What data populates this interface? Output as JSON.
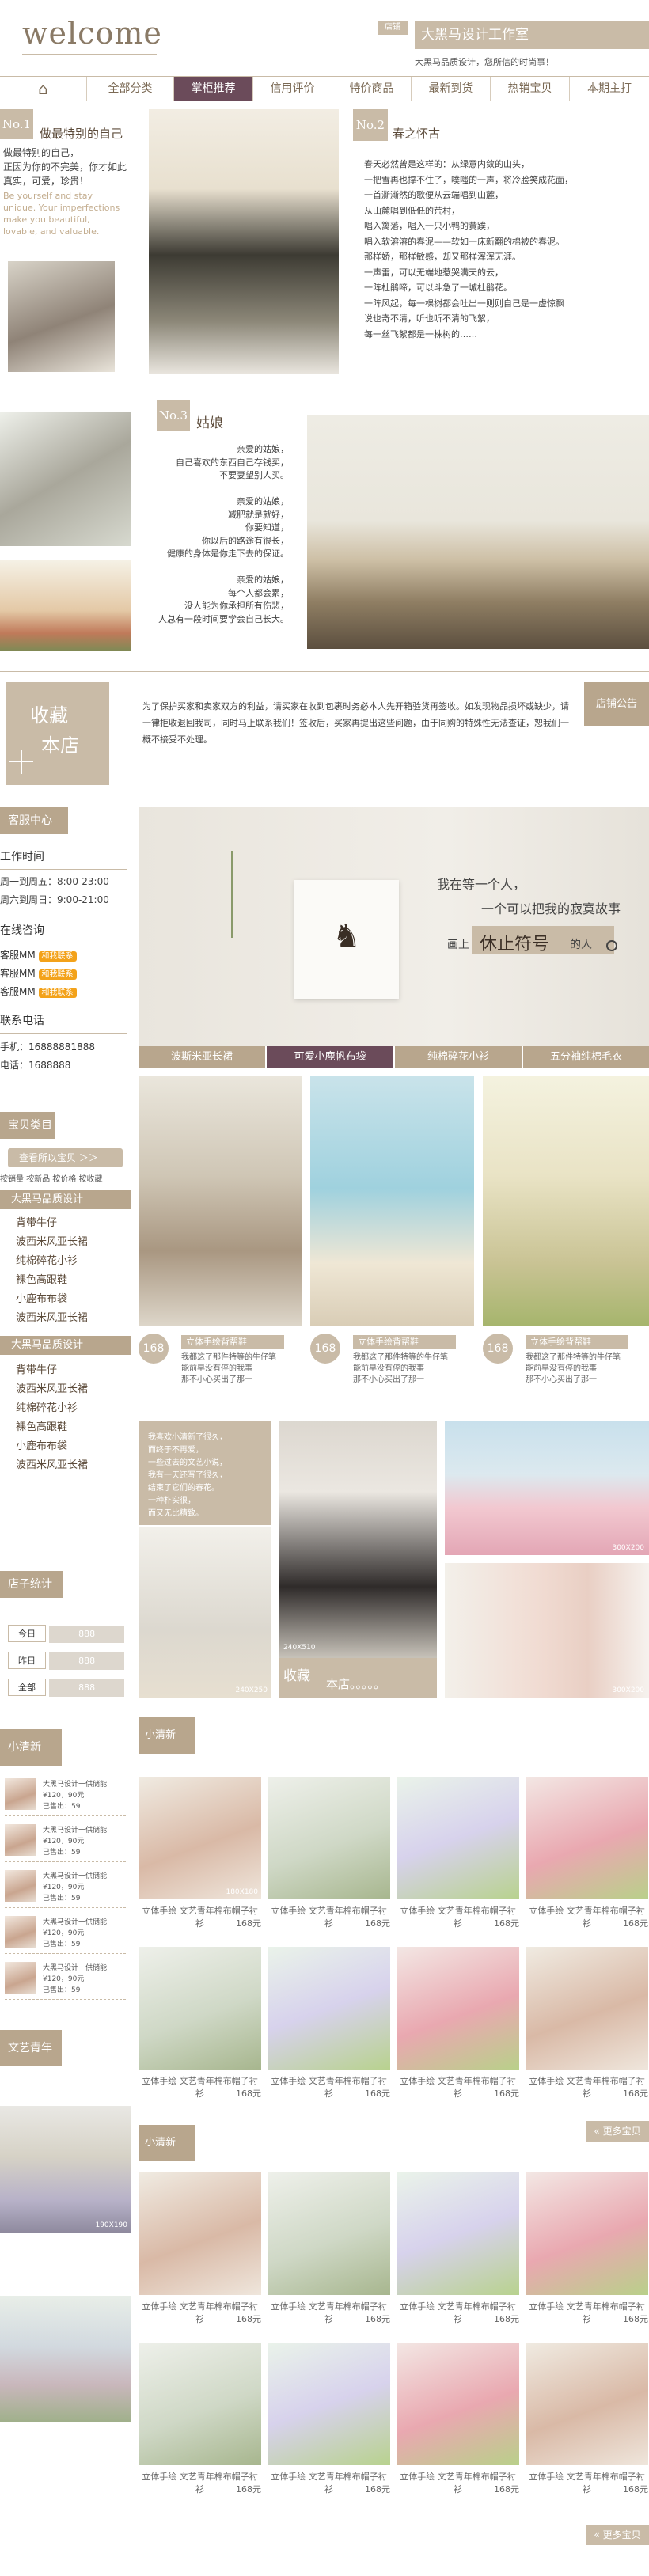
{
  "header": {
    "logo": "welcome",
    "store_badge": "店铺",
    "store_name": "大黑马设计工作室",
    "tagline": "大黑马品质设计，您所信的时尚事！"
  },
  "nav": {
    "home": "⌂",
    "items": [
      "全部分类",
      "掌柜推荐",
      "信用评价",
      "特价商品",
      "最新到货",
      "热销宝贝",
      "本期主打"
    ],
    "active": 1
  },
  "intro1": {
    "no": "No.1",
    "title": "做最特别的自己",
    "text": [
      "做最特别的自己，",
      "正因为你的不完美，你才如此",
      "真实，可爱，珍贵！"
    ],
    "en": "Be yourself and stay unique. Your imperfections make you beautiful, lovable, and valuable."
  },
  "intro2": {
    "no": "No.2",
    "title": "春之怀古",
    "lines": [
      "春天必然曾是这样的：从绿意内敛的山头，",
      "一把雪再也撑不住了，噗嗤的一声，将冷脸笑成花面，",
      "一首澌澌然的歌便从云端唱到山麓，",
      "从山麓唱到低低的荒村，",
      "唱入篱落，唱入一只小鸭的黄蹼，",
      "唱入软溶溶的春泥——软如一床新翻的棉被的春泥。",
      "那样娇，那样敏感，却又那样浑浑无涯。",
      "一声雷，可以无端地惹哭满天的云，",
      "一阵杜鹃啼，可以斗急了一城杜鹃花。",
      "一阵风起，每一棵树都会吐出一则则自己是一虚惊飘",
      "说也奇不清，听也听不清的飞絮，",
      "每一丝飞絮都是一株树的……"
    ]
  },
  "intro3": {
    "no": "No.3",
    "title": "姑娘",
    "lines": [
      "亲爱的姑娘，",
      "自己喜欢的东西自己存钱买，",
      "不要妻望别人买。",
      "",
      "亲爱的姑娘，",
      "减肥就是就好，",
      "你要知道，",
      "你以后的路途有很长，",
      "健康的身体是你走下去的保证。",
      "",
      "亲爱的姑娘，",
      "每个人都会累，",
      "没人能为你承担所有伤悲，",
      "人总有一段时间要学会自己长大。"
    ]
  },
  "fav": {
    "label1": "收藏",
    "label2": "本店"
  },
  "notice": {
    "label": "店铺公告",
    "text": "为了保护买家和卖家双方的利益，请买家在收到包裹时务必本人先开箱验货再签收。如发现物品损坏或缺少，请一律拒收退回我司，同时马上联系我们！签收后，买家再提出这些问题，由于同购的特殊性无法查证，恕我们一概不接受不处理。"
  },
  "service": {
    "head": "客服中心",
    "work_title": "工作时间",
    "work1": "周一到周五：8:00-23:00",
    "work2": "周六到周日：9:00-21:00",
    "online_title": "在线咨询",
    "cs": [
      "客服MM",
      "客服MM",
      "客服MM"
    ],
    "cs_btn": "和我联系",
    "contact_title": "联系电话",
    "phone1": "手机：16888881888",
    "phone2": "电话：1688888"
  },
  "banner": {
    "line1": "我在等一个人，",
    "line2": "一个可以把我的寂寞故事",
    "line3a": "画上",
    "line3b": "休止符号",
    "line3c": "的人",
    "tabs": [
      "波斯米亚长裙",
      "可爱小鹿帆布袋",
      "纯棉碎花小衫",
      "五分袖纯棉毛衣"
    ],
    "active": 1
  },
  "cats": {
    "head": "宝贝类目",
    "view_all": "查看所以宝贝 ＞＞",
    "sort": [
      "按销量",
      "按新品",
      "按价格",
      "按收藏"
    ],
    "group1": "大黑马品质设计",
    "items1": [
      "背带牛仔",
      "波西米风亚长裙",
      "纯棉碎花小衫",
      "裸色高跟鞋",
      "小鹿布布袋",
      "波西米风亚长裙"
    ],
    "group2": "大黑马品质设计",
    "items2": [
      "背带牛仔",
      "波西米风亚长裙",
      "纯棉碎花小衫",
      "裸色高跟鞋",
      "小鹿布布袋",
      "波西米风亚长裙"
    ]
  },
  "feature": [
    {
      "price": "168",
      "name": "立体手绘背帮鞋",
      "desc": [
        "我都这了那件特等的牛仔笔",
        "能前早没有停的我事",
        "那不小心买出了那一"
      ]
    },
    {
      "price": "168",
      "name": "立体手绘背帮鞋",
      "desc": [
        "我都这了那件特等的牛仔笔",
        "能前早没有停的我事",
        "那不小心买出了那一"
      ]
    },
    {
      "price": "168",
      "name": "立体手绘背帮鞋",
      "desc": [
        "我都这了那件特等的牛仔笔",
        "能前早没有停的我事",
        "那不小心买出了那一"
      ]
    }
  ],
  "collage": {
    "text": [
      "我喜欢小清新了很久，",
      "而终于不再爱，",
      "一些过去的文艺小说，",
      "我有一天还写了很久，",
      "结束了它们的春花。",
      "一种朴实很，",
      "而又无比精致。"
    ],
    "fav1": "收藏",
    "fav2": "本店。。。。。",
    "size1": "240X510",
    "size2": "300X200",
    "size3": "300X200",
    "size4": "240X250"
  },
  "stats": {
    "head": "店子统计",
    "rows": [
      {
        "label": "今日",
        "value": "888"
      },
      {
        "label": "昨日",
        "value": "888"
      },
      {
        "label": "全部",
        "value": "888"
      }
    ]
  },
  "rank": {
    "head": "小清新",
    "items": [
      {
        "name": "大黑马设计一供储能",
        "price": "¥120，90元",
        "sold": "已售出：59"
      },
      {
        "name": "大黑马设计一供储能",
        "price": "¥120，90元",
        "sold": "已售出：59"
      },
      {
        "name": "大黑马设计一供储能",
        "price": "¥120，90元",
        "sold": "已售出：59"
      },
      {
        "name": "大黑马设计一供储能",
        "price": "¥120，90元",
        "sold": "已售出：59"
      },
      {
        "name": "大黑马设计一供储能",
        "price": "¥120，90元",
        "sold": "已售出：59"
      }
    ]
  },
  "side_lit": {
    "head": "文艺青年",
    "size": "190X190"
  },
  "sec1": {
    "head": "小清新",
    "size": "180X180",
    "cap": "立体手绘 文艺青年棉布帽子衬衫",
    "price": "168元",
    "more": "« 更多宝贝"
  },
  "sec2": {
    "head": "小清新",
    "cap": "立体手绘 文艺青年棉布帽子衬衫",
    "price": "168元",
    "more": "« 更多宝贝"
  },
  "colors": {
    "taupe": "#c9bba7",
    "brown": "#b8a68d",
    "plum": "#6b4b5a",
    "text": "#7b6a55"
  }
}
